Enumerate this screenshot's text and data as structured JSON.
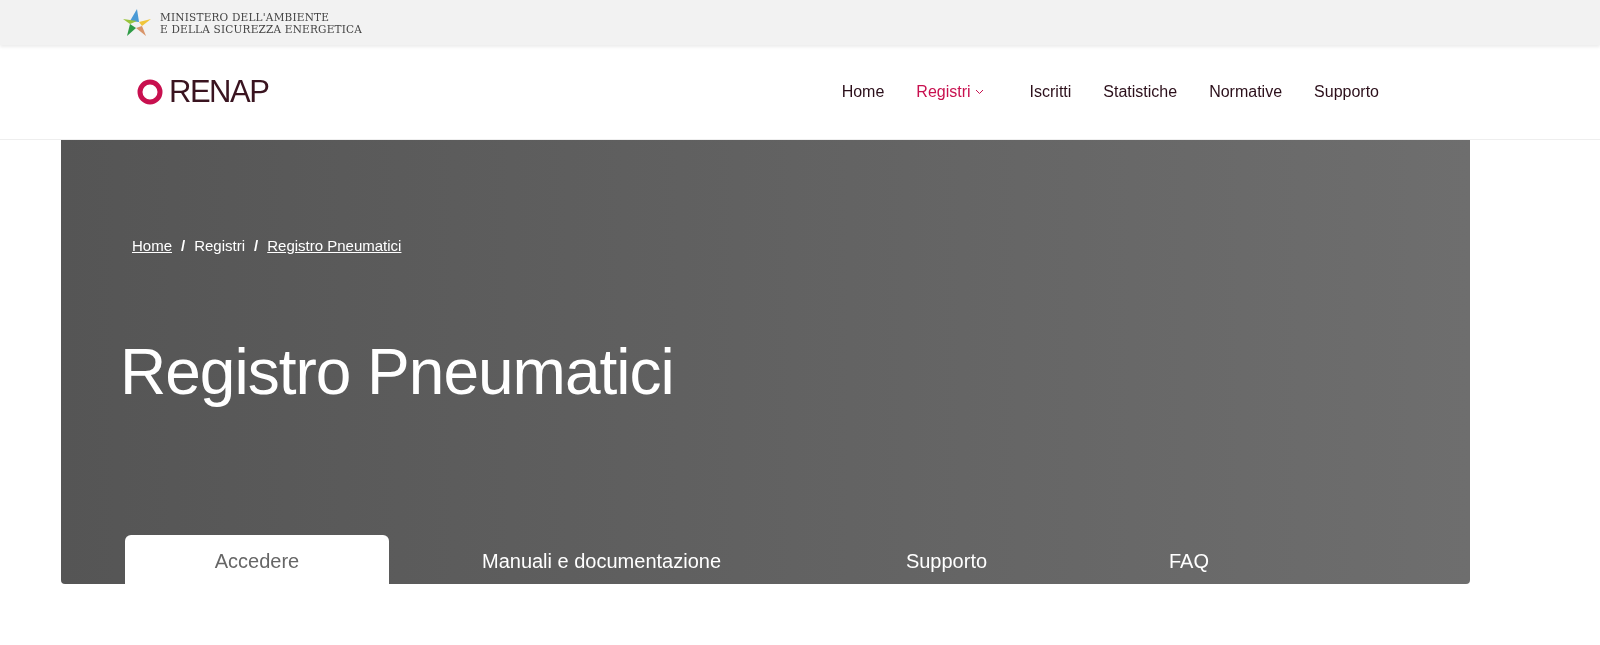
{
  "ministry": {
    "lines": [
      "MINISTERO DELL'AMBIENTE",
      "E DELLA SICUREZZA ENERGETICA"
    ]
  },
  "brand": {
    "name": "RENAP"
  },
  "nav": [
    {
      "label": "Home",
      "selected": false,
      "dropdown": false
    },
    {
      "label": "Registri",
      "selected": true,
      "dropdown": true
    },
    {
      "label": "Iscritti",
      "selected": false,
      "dropdown": false
    },
    {
      "label": "Statistiche",
      "selected": false,
      "dropdown": false
    },
    {
      "label": "Normative",
      "selected": false,
      "dropdown": false
    },
    {
      "label": "Supporto",
      "selected": false,
      "dropdown": false
    }
  ],
  "breadcrumb": [
    {
      "label": "Home",
      "kind": "link"
    },
    {
      "label": "/",
      "kind": "separator"
    },
    {
      "label": "Registri",
      "kind": "text"
    },
    {
      "label": "/",
      "kind": "separator"
    },
    {
      "label": "Registro Pneumatici",
      "kind": "link"
    }
  ],
  "hero": {
    "title": "Registro Pneumatici"
  },
  "tabs": [
    {
      "label": "Accedere",
      "selected": true
    },
    {
      "label": "Manuali e documentazione",
      "selected": false
    },
    {
      "label": "Supporto",
      "selected": false
    },
    {
      "label": "FAQ",
      "selected": false
    }
  ]
}
